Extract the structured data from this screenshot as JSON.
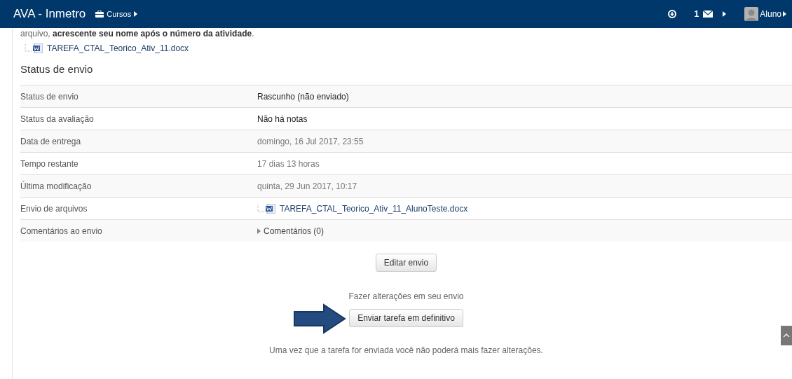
{
  "navbar": {
    "brand": "AVA - Inmetro",
    "menu": "Cursos",
    "message_count": "1",
    "user": "Aluno"
  },
  "intro": {
    "text": "arquivo, **acrescente seu nome após o número da atividade**.",
    "file": "TAREFA_CTAL_Teorico_Ativ_11.docx"
  },
  "section_title": "Status de envio",
  "rows": [
    {
      "label": "Status de envio",
      "value": "Rascunho (não enviado)",
      "kind": "status"
    },
    {
      "label": "Status da avaliação",
      "value": "Não há notas",
      "kind": "status"
    },
    {
      "label": "Data de entrega",
      "value": "domingo, 16 Jul 2017, 23:55",
      "kind": "plain"
    },
    {
      "label": "Tempo restante",
      "value": "17 dias 13 horas",
      "kind": "plain"
    },
    {
      "label": "Última modificação",
      "value": "quinta, 29 Jun 2017, 10:17",
      "kind": "plain"
    },
    {
      "label": "Envio de arquivos",
      "value": "TAREFA_CTAL_Teorico_Ativ_11_AlunoTeste.docx",
      "kind": "file"
    },
    {
      "label": "Comentários ao envio",
      "value": "Comentários (0)",
      "kind": "comments"
    }
  ],
  "edit_button": "Editar envio",
  "changes_note": "Fazer alterações em seu envio",
  "submit_button": "Enviar tarefa em definitivo",
  "warning": "Uma vez que a tarefa for enviada você não poderá mais fazer alterações."
}
